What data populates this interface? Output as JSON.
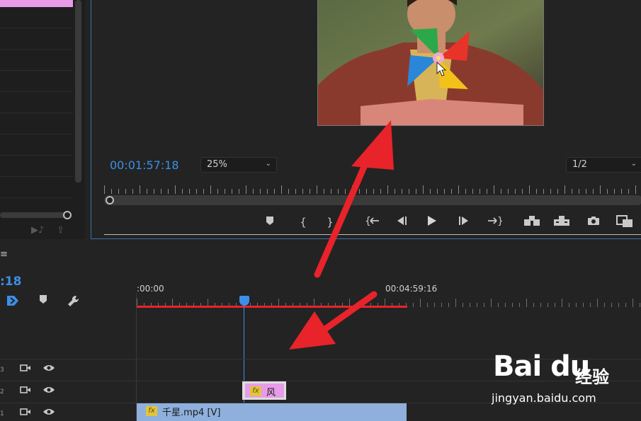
{
  "monitor": {
    "timecode": "00:01:57:18",
    "zoom_level": "25%",
    "resolution": "1/2",
    "controls": [
      {
        "name": "add-marker-button",
        "glyph": "⬟"
      },
      {
        "name": "mark-in-button",
        "glyph": "{"
      },
      {
        "name": "mark-out-button",
        "glyph": "}"
      },
      {
        "name": "go-to-in-button",
        "glyph": "{⇤"
      },
      {
        "name": "step-back-button",
        "glyph": "◀|"
      },
      {
        "name": "play-button",
        "glyph": "▶"
      },
      {
        "name": "step-forward-button",
        "glyph": "|▶"
      },
      {
        "name": "go-to-out-button",
        "glyph": "⇥}"
      },
      {
        "name": "lift-button",
        "glyph": "⊟"
      },
      {
        "name": "extract-button",
        "glyph": "⊞"
      },
      {
        "name": "export-frame-button",
        "glyph": "📷"
      },
      {
        "name": "comparison-view-button",
        "glyph": "▣"
      }
    ]
  },
  "timeline": {
    "timecode": ":18",
    "ruler_start": ":00:00",
    "ruler_end": "00:04:59:16",
    "tracks": [
      {
        "label": "3"
      },
      {
        "label": "2"
      },
      {
        "label": "1"
      }
    ],
    "clips": {
      "v2_title": "风",
      "v1_title": "千星.mp4 [V]",
      "fx": "fx"
    }
  },
  "watermark": {
    "logo": "Bai du",
    "cn": "经验",
    "url": "jingyan.baidu.com"
  },
  "colors": {
    "accent_blue": "#3c8fe8",
    "work_area_red": "#e8232a",
    "clip_pink": "#e89be9",
    "clip_blue": "#8fb0dc",
    "arrow_red": "#e8232a"
  }
}
